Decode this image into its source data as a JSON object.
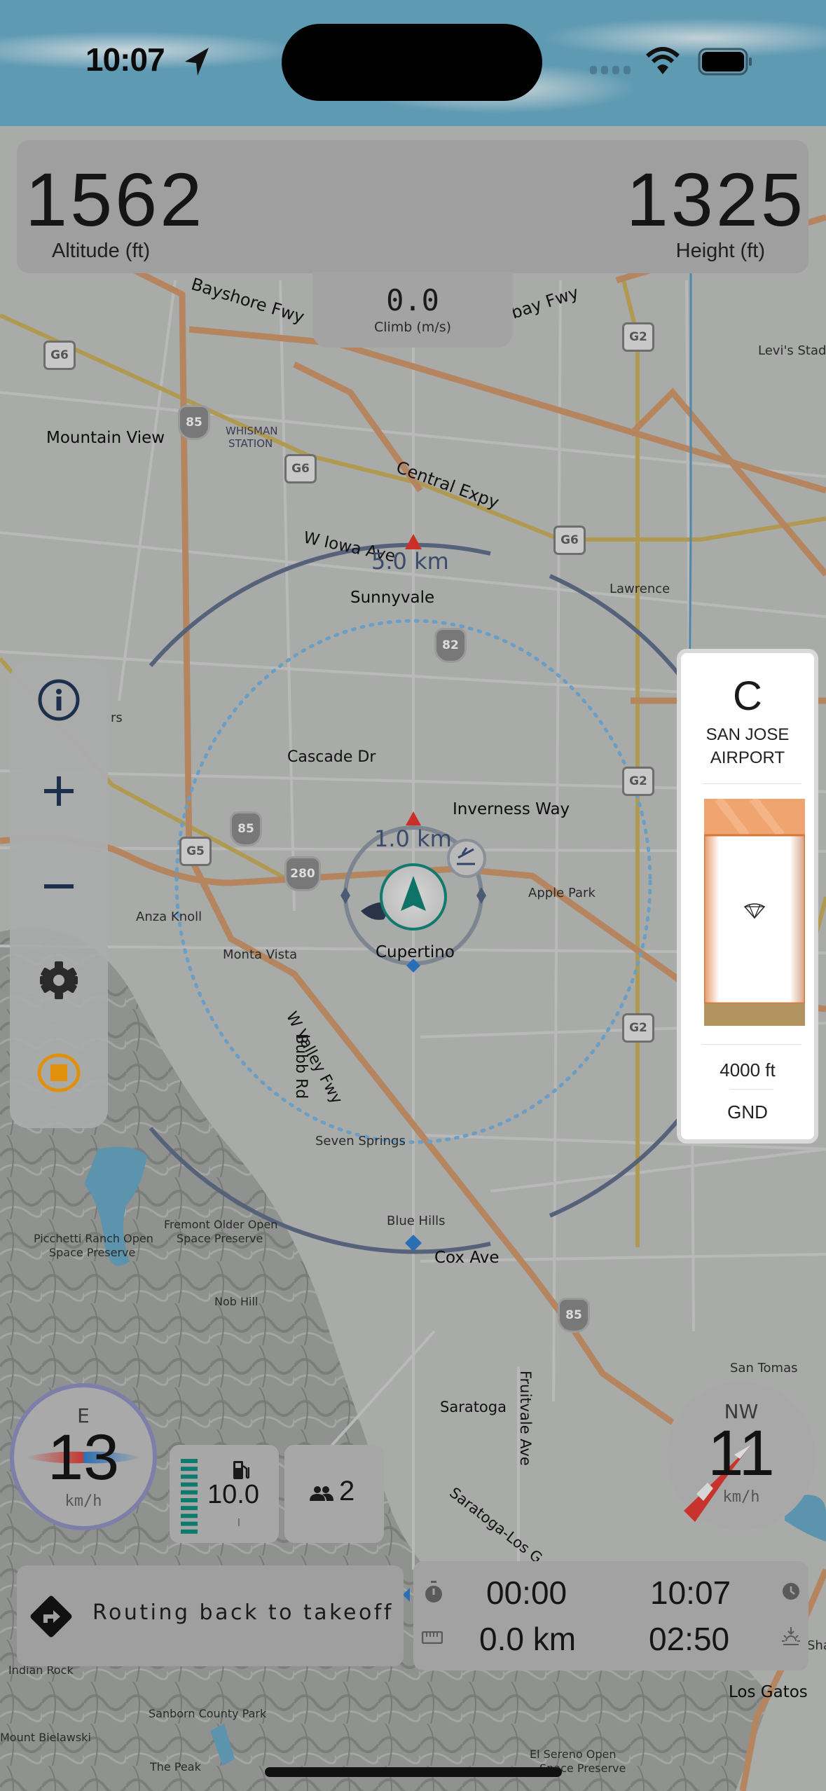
{
  "status_bar": {
    "time": "10:07",
    "location_icon": "location-arrow-icon",
    "wifi_icon": "wifi-icon",
    "battery_icon": "battery-icon",
    "signal_icon": "cellular-signal-icon"
  },
  "altitude_panel": {
    "altitude_value": "1562",
    "altitude_label": "Altitude (ft)",
    "height_value": "1325",
    "height_label": "Height (ft)"
  },
  "climb_panel": {
    "value": "0.0",
    "label": "Climb (m/s)"
  },
  "toolbar": {
    "items": [
      {
        "name": "info",
        "icon": "info-icon"
      },
      {
        "name": "zoom-in",
        "icon": "plus-icon"
      },
      {
        "name": "zoom-out",
        "icon": "minus-icon"
      },
      {
        "name": "settings",
        "icon": "gear-icon"
      },
      {
        "name": "stop-recording",
        "icon": "stop-record-icon",
        "color": "#e8940a"
      }
    ]
  },
  "airspace_card": {
    "class": "C",
    "name_line1": "SAN JOSE",
    "name_line2": "AIRPORT",
    "upper_limit": "4000 ft",
    "lower_limit": "GND",
    "icon": "paraglider-icon",
    "border_color": "#e07a38",
    "ground_color": "#b0935e"
  },
  "map": {
    "range_rings": [
      {
        "label": "5.0 km"
      },
      {
        "label": "1.0 km"
      }
    ],
    "labels": [
      {
        "text": "Bayshore Fwy",
        "kind": "road"
      },
      {
        "text": "bay Fwy",
        "kind": "road"
      },
      {
        "text": "Mountain View",
        "kind": "city"
      },
      {
        "text": "WHISMAN",
        "kind": "station"
      },
      {
        "text": "STATION",
        "kind": "station"
      },
      {
        "text": "Central Expy",
        "kind": "road"
      },
      {
        "text": "W Iowa Ave",
        "kind": "road"
      },
      {
        "text": "Sunnyvale",
        "kind": "city"
      },
      {
        "text": "Lawrence",
        "kind": "place"
      },
      {
        "text": "Levi's Stadiu",
        "kind": "poi"
      },
      {
        "text": "Cascade Dr",
        "kind": "road"
      },
      {
        "text": "Inverness Way",
        "kind": "road"
      },
      {
        "text": "Apple Park",
        "kind": "poi"
      },
      {
        "text": "Anza Knoll",
        "kind": "peak"
      },
      {
        "text": "Monta Vista",
        "kind": "place"
      },
      {
        "text": "Cupertino",
        "kind": "city"
      },
      {
        "text": "W Valley Fwy",
        "kind": "road"
      },
      {
        "text": "Bubb Rd",
        "kind": "road"
      },
      {
        "text": "Seven Springs",
        "kind": "place"
      },
      {
        "text": "Picchetti Ranch Open",
        "kind": "park"
      },
      {
        "text": "Space Preserve",
        "kind": "park"
      },
      {
        "text": "Fremont Older Open",
        "kind": "park"
      },
      {
        "text": "Space Preserve",
        "kind": "park"
      },
      {
        "text": "Nob Hill",
        "kind": "peak"
      },
      {
        "text": "Blue Hills",
        "kind": "place"
      },
      {
        "text": "Cox Ave",
        "kind": "road"
      },
      {
        "text": "San Tomas",
        "kind": "place"
      },
      {
        "text": "Saratoga",
        "kind": "city"
      },
      {
        "text": "Fruitvale Ave",
        "kind": "road"
      },
      {
        "text": "Saratoga-Los G",
        "kind": "road"
      },
      {
        "text": "Indian Rock",
        "kind": "peak"
      },
      {
        "text": "Sanborn County Park",
        "kind": "park"
      },
      {
        "text": "Mount Bielawski",
        "kind": "peak"
      },
      {
        "text": "The Peak",
        "kind": "peak"
      },
      {
        "text": "El Sereno Open",
        "kind": "park"
      },
      {
        "text": "Space Preserve",
        "kind": "park"
      },
      {
        "text": "Los Gatos",
        "kind": "city"
      },
      {
        "text": "rs",
        "kind": "fragment"
      },
      {
        "text": "Sha",
        "kind": "fragment"
      }
    ],
    "shields": [
      "G6",
      "G6",
      "G6",
      "G2",
      "G2",
      "G2",
      "G5"
    ],
    "highways": [
      "85",
      "85",
      "85",
      "82",
      "280"
    ]
  },
  "ground_speed": {
    "direction": "E",
    "value": "13",
    "unit": "km/h"
  },
  "wind": {
    "direction": "NW",
    "value": "11",
    "unit": "km/h"
  },
  "fuel": {
    "icon": "fuel-pump-icon",
    "value": "10.0",
    "unit": "l",
    "level_bars": 10,
    "level_fraction": 1.0,
    "bar_color": "#0e7a6e"
  },
  "crew": {
    "icon": "people-icon",
    "value": "2"
  },
  "routing": {
    "icon": "turn-right-sign-icon",
    "text": "Routing back to takeoff"
  },
  "times": {
    "flight_time": "00:00",
    "clock_time": "10:07",
    "distance": "0.0 km",
    "sunset_remaining": "02:50",
    "stopwatch_icon": "stopwatch-icon",
    "clock_icon": "clock-icon",
    "ruler_icon": "ruler-icon",
    "sunset_icon": "sunset-icon"
  }
}
